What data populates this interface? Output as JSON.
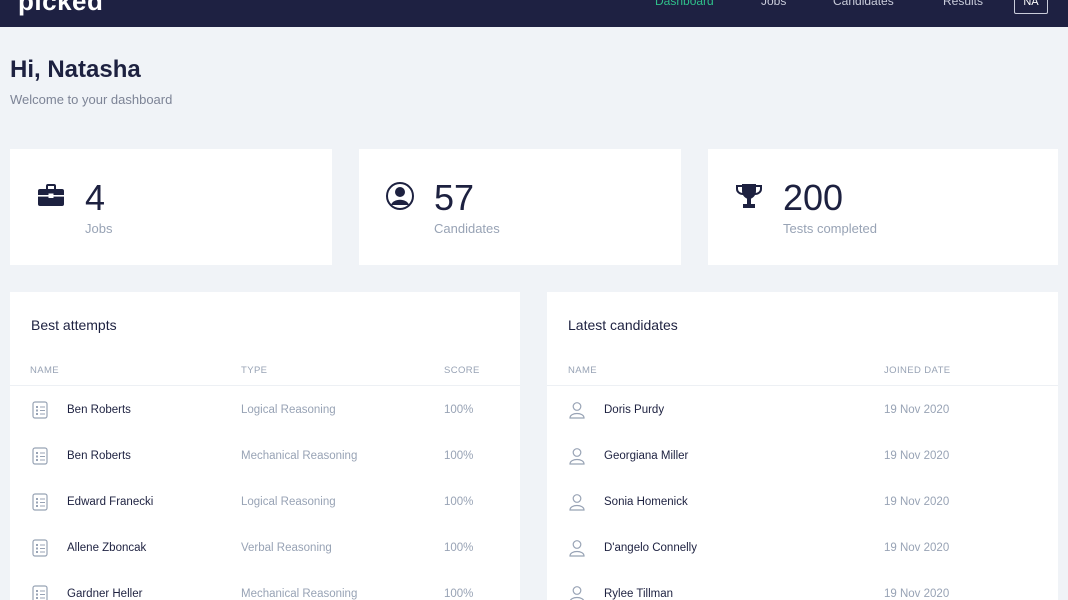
{
  "app": {
    "logo": "picked"
  },
  "nav": {
    "items": [
      {
        "label": "Dashboard",
        "active": true
      },
      {
        "label": "Jobs"
      },
      {
        "label": "Candidates"
      },
      {
        "label": "Results"
      }
    ],
    "user_initials": "NA"
  },
  "header": {
    "greeting": "Hi, Natasha",
    "subtitle": "Welcome to your dashboard"
  },
  "stats": [
    {
      "icon": "briefcase-icon",
      "value": "4",
      "label": "Jobs"
    },
    {
      "icon": "user-circle-icon",
      "value": "57",
      "label": "Candidates"
    },
    {
      "icon": "trophy-icon",
      "value": "200",
      "label": "Tests completed"
    }
  ],
  "best_attempts": {
    "title": "Best attempts",
    "columns": [
      "Name",
      "Type",
      "Score"
    ],
    "rows": [
      {
        "name": "Ben Roberts",
        "type": "Logical Reasoning",
        "score": "100%"
      },
      {
        "name": "Ben Roberts",
        "type": "Mechanical Reasoning",
        "score": "100%"
      },
      {
        "name": "Edward Franecki",
        "type": "Logical Reasoning",
        "score": "100%"
      },
      {
        "name": "Allene Zboncak",
        "type": "Verbal Reasoning",
        "score": "100%"
      },
      {
        "name": "Gardner Heller",
        "type": "Mechanical Reasoning",
        "score": "100%"
      }
    ]
  },
  "latest_candidates": {
    "title": "Latest candidates",
    "columns": [
      "Name",
      "Joined date"
    ],
    "rows": [
      {
        "name": "Doris Purdy",
        "joined": "19 Nov 2020"
      },
      {
        "name": "Georgiana Miller",
        "joined": "19 Nov 2020"
      },
      {
        "name": "Sonia Homenick",
        "joined": "19 Nov 2020"
      },
      {
        "name": "D'angelo Connelly",
        "joined": "19 Nov 2020"
      },
      {
        "name": "Rylee Tillman",
        "joined": "19 Nov 2020"
      }
    ]
  },
  "colors": {
    "navbar": "#1e2142",
    "accent": "#2fbf8a",
    "background": "#f0f3f7",
    "text": "#1d2140",
    "muted": "#98a3b5"
  }
}
